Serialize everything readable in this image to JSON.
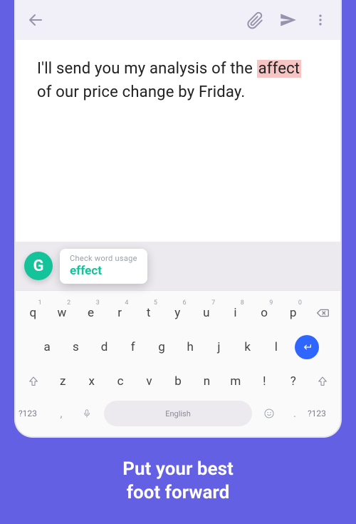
{
  "message": {
    "before": "I'll send you my analysis of the",
    "highlighted": "affect",
    "after": "of our price change by Friday."
  },
  "suggestion": {
    "label": "Check word usage",
    "word": "effect",
    "badge": "G"
  },
  "keyboard": {
    "row1": [
      {
        "k": "q",
        "n": "1"
      },
      {
        "k": "w",
        "n": "2"
      },
      {
        "k": "e",
        "n": "3"
      },
      {
        "k": "r",
        "n": "4"
      },
      {
        "k": "t",
        "n": "5"
      },
      {
        "k": "y",
        "n": "6"
      },
      {
        "k": "u",
        "n": "7"
      },
      {
        "k": "i",
        "n": "8"
      },
      {
        "k": "o",
        "n": "9"
      },
      {
        "k": "p",
        "n": "0"
      }
    ],
    "row2": [
      "a",
      "s",
      "d",
      "f",
      "g",
      "h",
      "j",
      "k",
      "l"
    ],
    "row3": [
      "z",
      "x",
      "c",
      "v",
      "b",
      "n",
      "m",
      "!",
      "?"
    ],
    "symKey": "?123",
    "comma": ",",
    "period": ".",
    "spaceLabel": "English"
  },
  "tagline": "Put your best\nfoot forward"
}
